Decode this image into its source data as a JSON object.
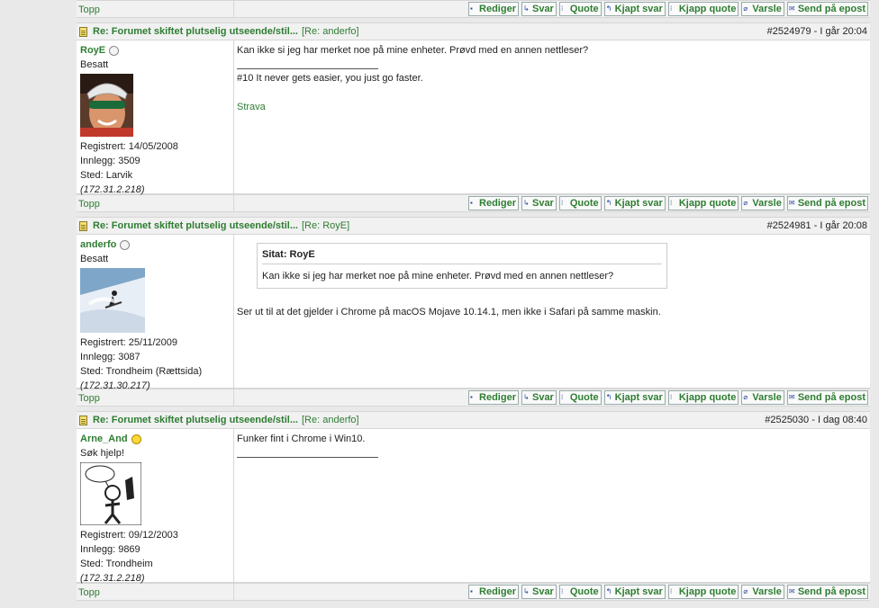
{
  "nav": {
    "top_label": "Topp"
  },
  "actions": [
    "Rediger",
    "Svar",
    "Quote",
    "Kjapt svar",
    "Kjapp quote",
    "Varsle",
    "Send på epost"
  ],
  "posts": [
    {
      "title": "Re: Forumet skiftet plutselig utseende/stil...",
      "re_prefix": "[Re: ",
      "re_user": "anderfo",
      "re_suffix": "]",
      "number": "#2524979 - ",
      "day": "I går",
      "time": "20:04",
      "author": {
        "name": "RoyE",
        "rank": "Besatt",
        "registered": "Registrert: 14/05/2008",
        "posts": "Innlegg: 3509",
        "location": "Sted: Larvik",
        "ip": "(172.31.2.218)"
      },
      "body": "Kan ikke si jeg har merket noe på mine enheter. Prøvd med en annen nettleser?",
      "signature": "#10 It never gets easier, you just go faster.",
      "link": "Strava"
    },
    {
      "title": "Re: Forumet skiftet plutselig utseende/stil...",
      "re_prefix": "[Re: ",
      "re_user": "RoyE",
      "re_suffix": "]",
      "number": "#2524981 - ",
      "day": "I går",
      "time": "20:08",
      "author": {
        "name": "anderfo",
        "rank": "Besatt",
        "registered": "Registrert: 25/11/2009",
        "posts": "Innlegg: 3087",
        "location": "Sted: Trondheim (Rættsida)",
        "ip": "(172.31.30.217)"
      },
      "quote_header": "Sitat: RoyE",
      "quote_text": "Kan ikke si jeg har merket noe på mine enheter. Prøvd med en annen nettleser?",
      "body": "Ser ut til at det gjelder i Chrome på macOS Mojave 10.14.1, men ikke i Safari på samme maskin."
    },
    {
      "title": "Re: Forumet skiftet plutselig utseende/stil...",
      "re_prefix": "[Re: ",
      "re_user": "anderfo",
      "re_suffix": "]",
      "number": "#2525030 - ",
      "day": "I dag",
      "time": "08:40",
      "author": {
        "name": "Arne_And",
        "rank": "Søk hjelp!",
        "registered": "Registrert: 09/12/2003",
        "posts": "Innlegg: 9869",
        "location": "Sted: Trondheim",
        "ip": "(172.31.2.218)"
      },
      "body": "Funker fint i Chrome i Win10."
    }
  ]
}
